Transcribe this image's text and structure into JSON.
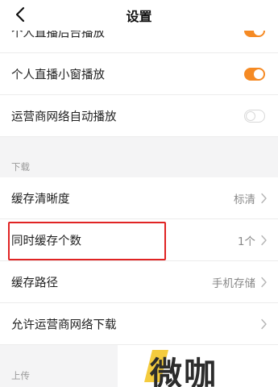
{
  "header": {
    "title": "设置"
  },
  "rows": {
    "personal_live_bg": {
      "label": "个人直播后台播放",
      "toggle": "on"
    },
    "personal_live_mini": {
      "label": "个人直播小窗播放",
      "toggle": "on"
    },
    "carrier_autoplay": {
      "label": "运营商网络自动播放",
      "toggle": "off"
    },
    "cache_quality": {
      "label": "缓存清晰度",
      "value": "标清"
    },
    "concurrent_cache": {
      "label": "同时缓存个数",
      "value": "1个"
    },
    "cache_path": {
      "label": "缓存路径",
      "value": "手机存储"
    },
    "carrier_download": {
      "label": "允许运营商网络下载"
    }
  },
  "sections": {
    "download": "下载",
    "upload": "上传"
  },
  "colors": {
    "accent_orange": "#f58a24",
    "highlight_red": "#e02424",
    "background": "#f4f4f5"
  },
  "watermark": {
    "text": "微咖"
  }
}
